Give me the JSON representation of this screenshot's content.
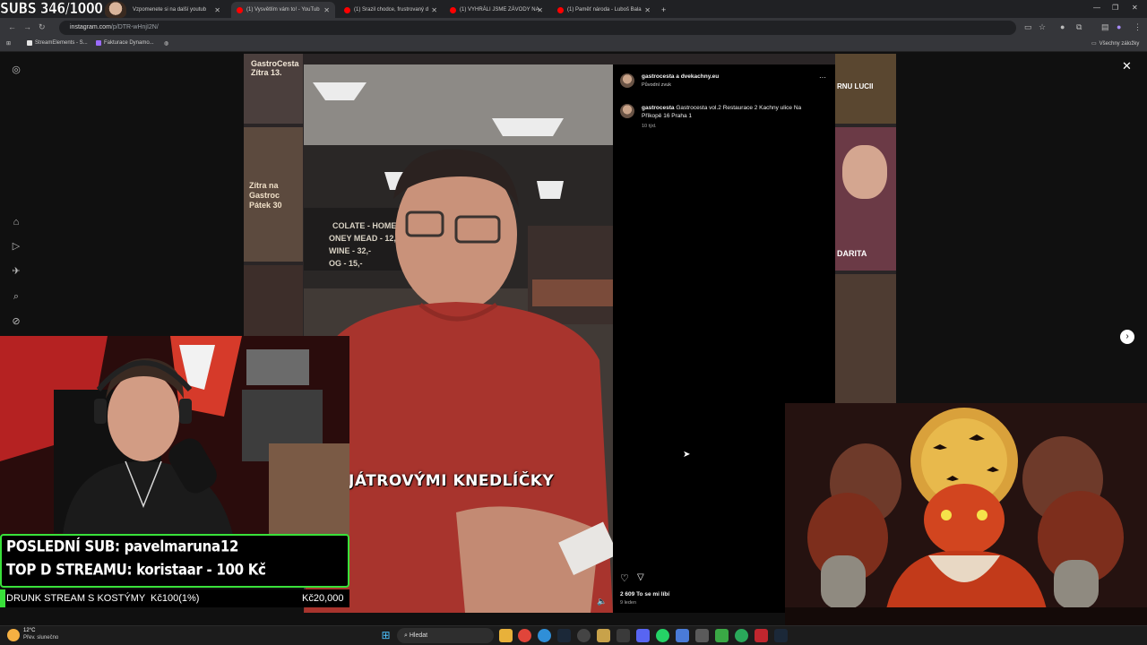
{
  "stream_logo": "SUBS 346/1000",
  "browser": {
    "tabs": [
      {
        "title": "Vzpomenete si na další youtub"
      },
      {
        "title": "(1) Vysvětlím vám to! - YouTub"
      },
      {
        "title": "(1) Srazil chodce, frustrovaný d"
      },
      {
        "title": "(1) VYHRÁLI JSME ZÁVODY NA"
      },
      {
        "title": "(1) Paměť národa - Luboš Bala"
      }
    ],
    "new_tab": "+",
    "url_host": "instagram.com",
    "url_path": "/p/DTR-wHnjI2N/",
    "bookmarks": [
      {
        "label": "StreamElements - S..."
      },
      {
        "label": "Fakturace Dynamo..."
      }
    ],
    "all_bookmarks": "Všechny záložky"
  },
  "instagram": {
    "header_user": "gastrocesta a dvekachny.eu",
    "header_audio": "Původní zvuk",
    "more": "···",
    "caption_user": "gastrocesta",
    "caption_text": "Gastrocesta vol.2 Restaurace 2 Kachny ulice Na Příkopě 16 Praha 1",
    "caption_time": "10 týd.",
    "likes": "2 609 To se mi líbí",
    "date": "9 leden",
    "close": "✕",
    "next": "›",
    "reel_subtitle": "JÁTROVÝMI KNEDLÍČKY",
    "reel_bg_text": [
      "COLATE - HOMEMADE",
      "ONEY MEAD - 12,-",
      "WINE - 32,-",
      "OG - 15,-"
    ]
  },
  "stream": {
    "last_sub": "POSLEDNÍ SUB: pavelmaruna12",
    "top_donor": "TOP D STREAMU: koristaar - 100 Kč",
    "goal_name": "DRUNK STREAM S KOSTÝMY",
    "goal_progress": "Kč100(1%)",
    "goal_target": "Kč20,000",
    "goal_fraction": 0.01
  },
  "taskbar": {
    "weather_temp": "12°C",
    "weather_desc": "Přev. slunečno",
    "search": "Hledat"
  },
  "background_tiles": [
    {
      "text": "GastroCesta Zítra 13."
    },
    {
      "text": "Zítra na Gastroc Pátek 30"
    },
    {
      "text": "RNU LUCII"
    },
    {
      "text": "DARITA"
    }
  ]
}
